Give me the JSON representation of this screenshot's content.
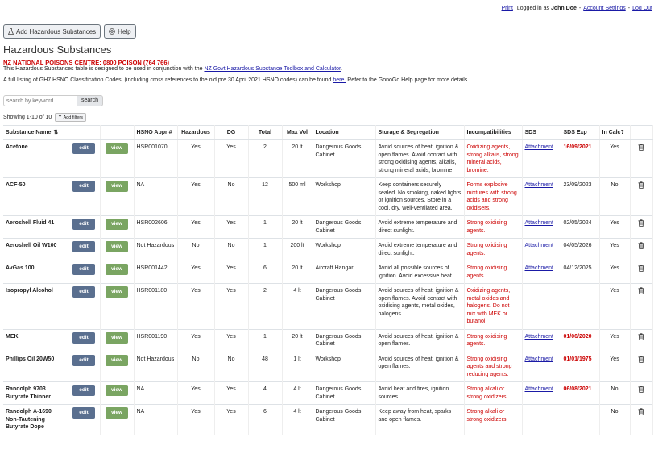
{
  "topbar": {
    "print": "Print",
    "logged_in_prefix": "Logged in as",
    "user": "John Doe",
    "account_settings": "Account Settings",
    "logout": "Log Out"
  },
  "toolbar": {
    "add_label": "Add Hazardous Substances",
    "help_label": "Help"
  },
  "page_title": "Hazardous Substances",
  "poison_notice": "NZ NATIONAL POISONS CENTRE: 0800 POISON (764 766)",
  "desc1": {
    "text": "This Hazardous Substances table is designed to be used in conjunction with the",
    "link": "NZ Govt Hazardous Substance Toolbox and Calculator",
    "end": "."
  },
  "desc2": {
    "text": "A full listing of GH7 HSNO Classification Codes, (including cross references to the old pre 30 April 2021 HSNO codes) can be found",
    "link": "here.",
    "end": "Refer to the GonoGo Help page for more details."
  },
  "search": {
    "placeholder": "search by keyword",
    "button": "search"
  },
  "showing": "Showing 1-10 of 10",
  "filters_label": "Add filters",
  "columns": [
    "Substance Name",
    "",
    "",
    "HSNO Appr #",
    "Hazardous",
    "DG",
    "Total",
    "Max Vol",
    "Location",
    "Storage & Segregation",
    "Incompatibilities",
    "SDS",
    "SDS Exp",
    "In Calc?",
    ""
  ],
  "edit_label": "edit",
  "view_label": "view",
  "rows": [
    {
      "name": "Acetone",
      "hsno": "HSR001070",
      "hazardous": "Yes",
      "dg": "Yes",
      "total": "2",
      "maxvol": "20 lt",
      "location": "Dangerous Goods Cabinet",
      "storage": "Avoid sources of heat, ignition & open flames. Avoid contact with strong oxidising agents, alkalis, strong mineral acids, bromine",
      "incomp": "Oxidizing agents, strong alkalis, strong mineral acids, bromine.",
      "sds": "Attachment",
      "sdsexp": "16/09/2021",
      "expired": true,
      "incalc": "Yes"
    },
    {
      "name": "ACF-50",
      "hsno": "NA",
      "hazardous": "Yes",
      "dg": "No",
      "total": "12",
      "maxvol": "500 ml",
      "location": "Workshop",
      "storage": "Keep containers securely sealed. No smoking, naked lights or ignition sources. Store in a cool, dry, well-ventilated area.",
      "incomp": "Forms explosive mixtures with strong acids and strong oxidisers.",
      "sds": "Attachment",
      "sdsexp": "23/09/2023",
      "expired": false,
      "incalc": "No"
    },
    {
      "name": "Aeroshell Fluid 41",
      "hsno": "HSR002606",
      "hazardous": "Yes",
      "dg": "Yes",
      "total": "1",
      "maxvol": "20 lt",
      "location": "Dangerous Goods Cabinet",
      "storage": "Avoid extreme temperature and direct sunlight.",
      "incomp": "Strong oxidising agents.",
      "sds": "Attachment",
      "sdsexp": "02/05/2024",
      "expired": false,
      "incalc": "Yes"
    },
    {
      "name": "Aeroshell Oil W100",
      "hsno": "Not Hazardous",
      "hazardous": "No",
      "dg": "No",
      "total": "1",
      "maxvol": "200 lt",
      "location": "Workshop",
      "storage": "Avoid extreme temperature and direct sunlight.",
      "incomp": "Strong oxidising agents.",
      "sds": "Attachment",
      "sdsexp": "04/05/2026",
      "expired": false,
      "incalc": "Yes"
    },
    {
      "name": "AvGas 100",
      "hsno": "HSR001442",
      "hazardous": "Yes",
      "dg": "Yes",
      "total": "6",
      "maxvol": "20 lt",
      "location": "Aircraft Hangar",
      "storage": "Avoid all possible sources of ignition. Avoid excessive heat.",
      "incomp": "Strong oxidising agents.",
      "sds": "Attachment",
      "sdsexp": "04/12/2025",
      "expired": false,
      "incalc": "Yes"
    },
    {
      "name": "Isopropyl Alcohol",
      "hsno": "HSR001180",
      "hazardous": "Yes",
      "dg": "Yes",
      "total": "2",
      "maxvol": "4 lt",
      "location": "Dangerous Goods Cabinet",
      "storage": "Avoid sources of heat, ignition & open flames. Avoid contact with oxidising agents, metal oxides, halogens.",
      "incomp": "Oxidizing agents, metal oxides and halogens. Do not mix with MEK or butanol.",
      "sds": "",
      "sdsexp": "",
      "expired": false,
      "incalc": "Yes"
    },
    {
      "name": "MEK",
      "hsno": "HSR001190",
      "hazardous": "Yes",
      "dg": "Yes",
      "total": "1",
      "maxvol": "20 lt",
      "location": "Dangerous Goods Cabinet",
      "storage": "Avoid sources of heat, ignition & open flames.",
      "incomp": "Strong oxidising agents.",
      "sds": "Attachment",
      "sdsexp": "01/06/2020",
      "expired": true,
      "incalc": "Yes"
    },
    {
      "name": "Phillips Oil 20W50",
      "hsno": "Not Hazardous",
      "hazardous": "No",
      "dg": "No",
      "total": "48",
      "maxvol": "1 lt",
      "location": "Workshop",
      "storage": "Avoid sources of heat, ignition & open flames.",
      "incomp": "Strong oxidising agents and strong reducing agents.",
      "sds": "Attachment",
      "sdsexp": "01/01/1975",
      "expired": true,
      "incalc": "Yes"
    },
    {
      "name": "Randolph 9703 Butyrate Thinner",
      "hsno": "NA",
      "hazardous": "Yes",
      "dg": "Yes",
      "total": "4",
      "maxvol": "4 lt",
      "location": "Dangerous Goods Cabinet",
      "storage": "Avoid heat and fires, ignition sources.",
      "incomp": "Strong alkali or strong oxidizers.",
      "sds": "Attachment",
      "sdsexp": "06/08/2021",
      "expired": true,
      "incalc": "No"
    },
    {
      "name": "Randolph A-1690 Non-Tautening Butyrate Dope",
      "hsno": "NA",
      "hazardous": "Yes",
      "dg": "Yes",
      "total": "6",
      "maxvol": "4 lt",
      "location": "Dangerous Goods Cabinet",
      "storage": "Keep away from heat, sparks and open flames.",
      "incomp": "Strong alkali or strong oxidizers.",
      "sds": "",
      "sdsexp": "",
      "expired": false,
      "incalc": "No"
    }
  ]
}
